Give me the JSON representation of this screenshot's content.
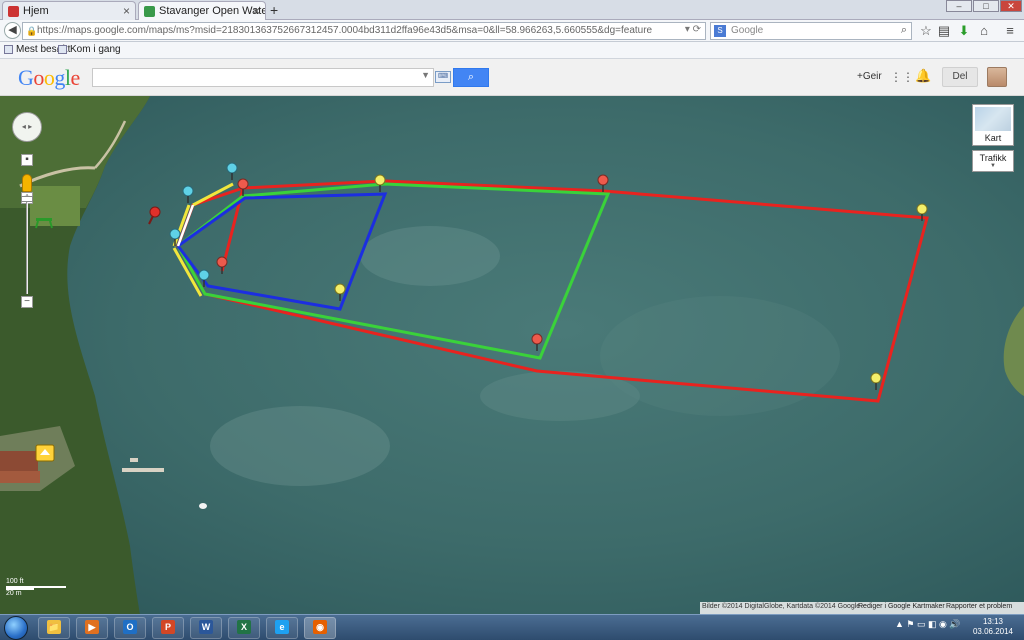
{
  "browser": {
    "tabs": [
      {
        "label": "Hjem",
        "favicon_color": "#c33",
        "active": false
      },
      {
        "label": "Stavanger Open Water - G...",
        "favicon_color": "#3a9a4a",
        "active": true
      }
    ],
    "new_tab": "+",
    "window_controls": {
      "minimize": "–",
      "maximize": "□",
      "close": "✕"
    },
    "url": "https://maps.google.com/maps/ms?msid=218301363752667312457.0004bd311d2ffa96e43d5&msa=0&ll=58.966263,5.660555&dg=feature",
    "url_bold_part": "google.com",
    "search_placeholder": "Google",
    "search_engine_icon": "S"
  },
  "bookmarks": [
    {
      "label": "Mest besøkt"
    },
    {
      "label": "Kom i gang"
    }
  ],
  "google_header": {
    "logo_letters": [
      {
        "ch": "G",
        "color": "#4285f4"
      },
      {
        "ch": "o",
        "color": "#ea4335"
      },
      {
        "ch": "o",
        "color": "#fbbc05"
      },
      {
        "ch": "g",
        "color": "#4285f4"
      },
      {
        "ch": "l",
        "color": "#34a853"
      },
      {
        "ch": "e",
        "color": "#ea4335"
      }
    ],
    "search_value": "",
    "plus_user": "+Geir",
    "share_label": "Del"
  },
  "map": {
    "type_tile_label": "Kart",
    "traffic_label": "Trafikk",
    "scale_ft": "100 ft",
    "scale_m": "20 m",
    "attribution": "Bilder ©2014 DigitalGlobe, Kartdata ©2014 Google -",
    "edit_link": "Rediger i Google Kartmaker",
    "report_link": "Rapporter et problem",
    "route_colors": {
      "red": "#e8231f",
      "green": "#3ad23a",
      "blue": "#1c2ee0",
      "yellow": "#f2e63c"
    },
    "marker_colors": {
      "cyan": "#5fd1e6",
      "red": "#ee5a4c",
      "yellow": "#f4ef6a"
    }
  },
  "taskbar": {
    "apps": [
      {
        "name": "explorer",
        "glyph": "📁",
        "color": "#f0c040"
      },
      {
        "name": "media-player",
        "glyph": "▶",
        "color": "#e07020"
      },
      {
        "name": "outlook",
        "glyph": "O",
        "color": "#1f6fc5"
      },
      {
        "name": "powerpoint",
        "glyph": "P",
        "color": "#d24726"
      },
      {
        "name": "word",
        "glyph": "W",
        "color": "#2b579a"
      },
      {
        "name": "excel",
        "glyph": "X",
        "color": "#217346"
      },
      {
        "name": "internet-explorer",
        "glyph": "e",
        "color": "#1ea1f1"
      },
      {
        "name": "firefox",
        "glyph": "◉",
        "color": "#e66000"
      }
    ],
    "time": "13:13",
    "date": "03.06.2014"
  }
}
